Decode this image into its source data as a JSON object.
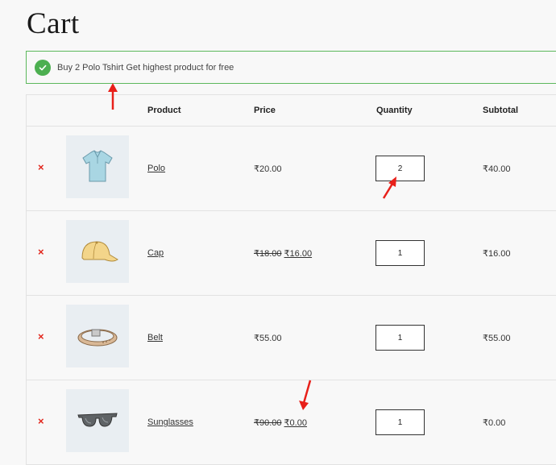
{
  "page": {
    "title": "Cart"
  },
  "notice": {
    "message": "Buy 2 Polo Tshirt Get highest product for free",
    "icon": "check-circle-icon",
    "color": "#4caf50"
  },
  "table": {
    "headers": {
      "product": "Product",
      "price": "Price",
      "quantity": "Quantity",
      "subtotal": "Subtotal"
    },
    "rows": [
      {
        "name": "Polo",
        "price": "₹20.00",
        "old_price": "",
        "quantity": "2",
        "subtotal": "₹40.00",
        "remove": "×",
        "image": "polo-shirt"
      },
      {
        "name": "Cap",
        "price": "₹16.00",
        "old_price": "₹18.00",
        "quantity": "1",
        "subtotal": "₹16.00",
        "remove": "×",
        "image": "cap"
      },
      {
        "name": "Belt",
        "price": "₹55.00",
        "old_price": "",
        "quantity": "1",
        "subtotal": "₹55.00",
        "remove": "×",
        "image": "belt"
      },
      {
        "name": "Sunglasses",
        "price": "₹0.00",
        "old_price": "₹90.00",
        "quantity": "1",
        "subtotal": "₹0.00",
        "remove": "×",
        "image": "sunglasses"
      }
    ]
  },
  "colors": {
    "remove": "#e2261c",
    "annotation_arrow": "#e8201a",
    "border": "#e2e2e2"
  }
}
